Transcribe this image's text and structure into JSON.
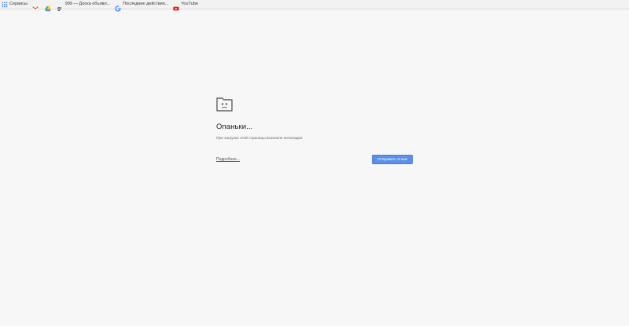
{
  "bookmarks": [
    {
      "icon": "apps-icon",
      "label": "Сервисы"
    },
    {
      "icon": "gmail-icon",
      "label": ""
    },
    {
      "icon": "drive-icon",
      "label": ""
    },
    {
      "icon": "999-icon",
      "label": "999 — Доска объявл..."
    },
    {
      "icon": "google-icon",
      "label": "Последние действия..."
    },
    {
      "icon": "youtube-icon",
      "label": "YouTube"
    }
  ],
  "error": {
    "icon": "sad-tab-icon",
    "title": "Опаньки...",
    "message": "При загрузке этой страницы возникли неполадки.",
    "learn_more": "Подробнее...",
    "feedback_button": "Отправить отзыв"
  },
  "colors": {
    "page_background": "#f7f7f7",
    "button_blue": "#5b90e8",
    "title_text": "#222222"
  }
}
